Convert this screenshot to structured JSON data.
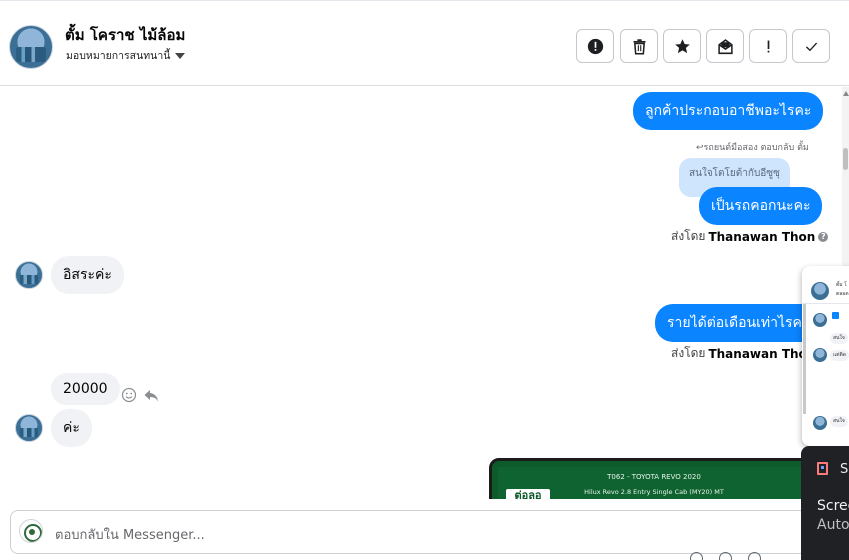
{
  "header": {
    "contact_name": "ตั้ม โคราช ไม้ล้อม",
    "assign_label": "มอบหมายการสนทนานี้"
  },
  "toolbar": {
    "buttons": [
      "report",
      "delete",
      "star",
      "mark-unread",
      "spam",
      "done"
    ]
  },
  "messages": {
    "out1": "ลูกค้าประกอบอาชีพอะไรคะ",
    "reply_hint": "↩รถยนต์มือสอง ตอบกลับ ตั้ม",
    "quoted": "สนใจโตโยต้ากับอีซูซุ",
    "out2": "เป็นรถคอกนะคะ",
    "sent_by_1_prefix": "ส่งโดย",
    "sent_by_1_name": "Thanawan Thon",
    "in1": "อิสระค่ะ",
    "out3": "รายได้ต่อเดือนเท่าไรคะ",
    "sent_by_2_prefix": "ส่งโดย",
    "sent_by_2_name": "Thanawan Thon",
    "in2": "20000",
    "in3": "ค่ะ"
  },
  "car_preview": {
    "line1": "T062 - TOYOTA REVO 2020",
    "line2": "Hilux Revo 2.8 Entry Single Cab (MY20) MT",
    "logo": "ต่อลอ"
  },
  "composer": {
    "placeholder": "ตอบกลับใน Messenger..."
  },
  "mini_popup": {
    "name": "ตั้ม โ",
    "name2": "ตลอด",
    "bubble1": "สนใจ",
    "bubble2": "แต่ติด",
    "bubble3": "สนใจ"
  },
  "notification": {
    "app_initial": "S",
    "title": "Scree",
    "subtitle": "Auto"
  },
  "colors": {
    "outgoing_bubble": "#0b84ff",
    "incoming_bubble": "#f0f2f5",
    "quoted_bubble": "#cfe4fd"
  }
}
